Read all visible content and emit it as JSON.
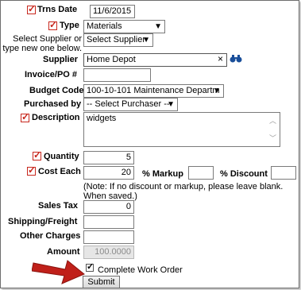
{
  "form": {
    "trns_date": {
      "label": "Trns Date",
      "value": "11/6/2015"
    },
    "type": {
      "label": "Type",
      "value": "Materials"
    },
    "supplier_select": {
      "label": "Select Supplier or type new one below.",
      "value": "Select Supplier"
    },
    "supplier": {
      "label": "Supplier",
      "value": "Home Depot",
      "clear": "×"
    },
    "invoice": {
      "label": "Invoice/PO #",
      "value": ""
    },
    "budget_code": {
      "label": "Budget Code",
      "value": "100-10-101 Maintenance Departm"
    },
    "purchased_by": {
      "label": "Purchased by",
      "value": "-- Select Purchaser --"
    },
    "description": {
      "label": "Description",
      "value": "widgets"
    },
    "quantity": {
      "label": "Quantity",
      "value": "5"
    },
    "cost_each": {
      "label": "Cost Each",
      "value": "20"
    },
    "markup": {
      "label": "% Markup",
      "value": ""
    },
    "discount": {
      "label": "% Discount",
      "value": ""
    },
    "note": "(Note: If no discount or markup, please leave blank. When saved.)",
    "sales_tax": {
      "label": "Sales Tax",
      "value": "0"
    },
    "shipping": {
      "label": "Shipping/Freight",
      "value": ""
    },
    "other": {
      "label": "Other Charges",
      "value": ""
    },
    "amount": {
      "label": "Amount",
      "value": "100.0000"
    },
    "complete_wo": {
      "label": "Complete Work Order",
      "checked": true
    },
    "submit": "Submit"
  },
  "icons": {
    "binoculars": "binoculars-icon",
    "pointer": "red-arrow-pointer"
  },
  "colors": {
    "required": "#c8281e",
    "arrow": "#c0201a"
  }
}
